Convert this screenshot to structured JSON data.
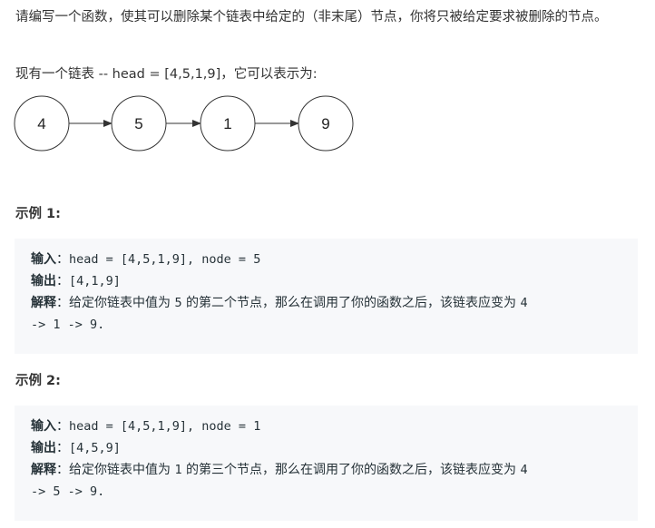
{
  "problem": {
    "description": "请编写一个函数，使其可以删除某个链表中给定的（非末尾）节点，你将只被给定要求被删除的节点。",
    "list_statement": "现有一个链表 -- head = [4,5,1,9]，它可以表示为:"
  },
  "diagram": {
    "nodes": [
      "4",
      "5",
      "1",
      "9"
    ],
    "arrow_color": "#333333",
    "circle_stroke": "#333333"
  },
  "examples": [
    {
      "title": "示例 1:",
      "input_label": "输入",
      "input_value": "head = [4,5,1,9], node = 5",
      "output_label": "输出",
      "output_value": "[4,1,9]",
      "explanation_label": "解释",
      "explanation_text_1": "给定你链表中值为 ",
      "explanation_node": "5",
      "explanation_text_2": " 的第二个节点，那么在调用了你的函数之后，该链表应变为 ",
      "explanation_result_start": "4",
      "explanation_result_end": "-> 1 -> 9."
    },
    {
      "title": "示例 2:",
      "input_label": "输入",
      "input_value": "head = [4,5,1,9], node = 1",
      "output_label": "输出",
      "output_value": "[4,5,9]",
      "explanation_label": "解释",
      "explanation_text_1": "给定你链表中值为 ",
      "explanation_node": "1",
      "explanation_text_2": " 的第三个节点，那么在调用了你的函数之后，该链表应变为 ",
      "explanation_result_start": "4",
      "explanation_result_end": "-> 5 -> 9."
    }
  ],
  "colon": "："
}
